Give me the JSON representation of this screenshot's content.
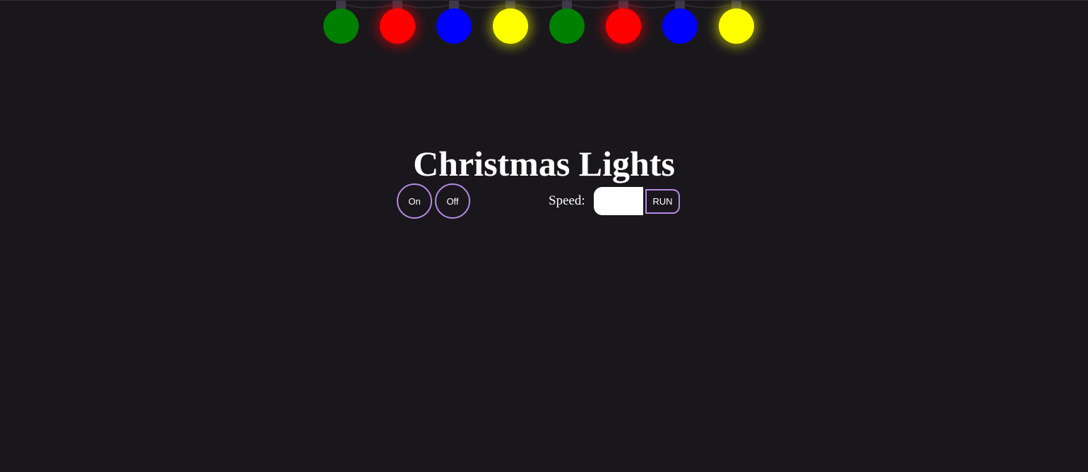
{
  "title": "Christmas Lights",
  "controls": {
    "on_label": "On",
    "off_label": "Off",
    "speed_label": "Speed:",
    "speed_value": "",
    "run_label": "RUN"
  },
  "lights": [
    {
      "color": "#008000",
      "glow": false
    },
    {
      "color": "#ff0000",
      "glow": true
    },
    {
      "color": "#0000ff",
      "glow": false
    },
    {
      "color": "#ffff00",
      "glow": true
    },
    {
      "color": "#008000",
      "glow": false
    },
    {
      "color": "#ff0000",
      "glow": true
    },
    {
      "color": "#0000ff",
      "glow": false
    },
    {
      "color": "#ffff00",
      "glow": true
    }
  ],
  "colors": {
    "background": "#1a171c",
    "accent": "#b38ae3",
    "socket": "#3e3848"
  }
}
